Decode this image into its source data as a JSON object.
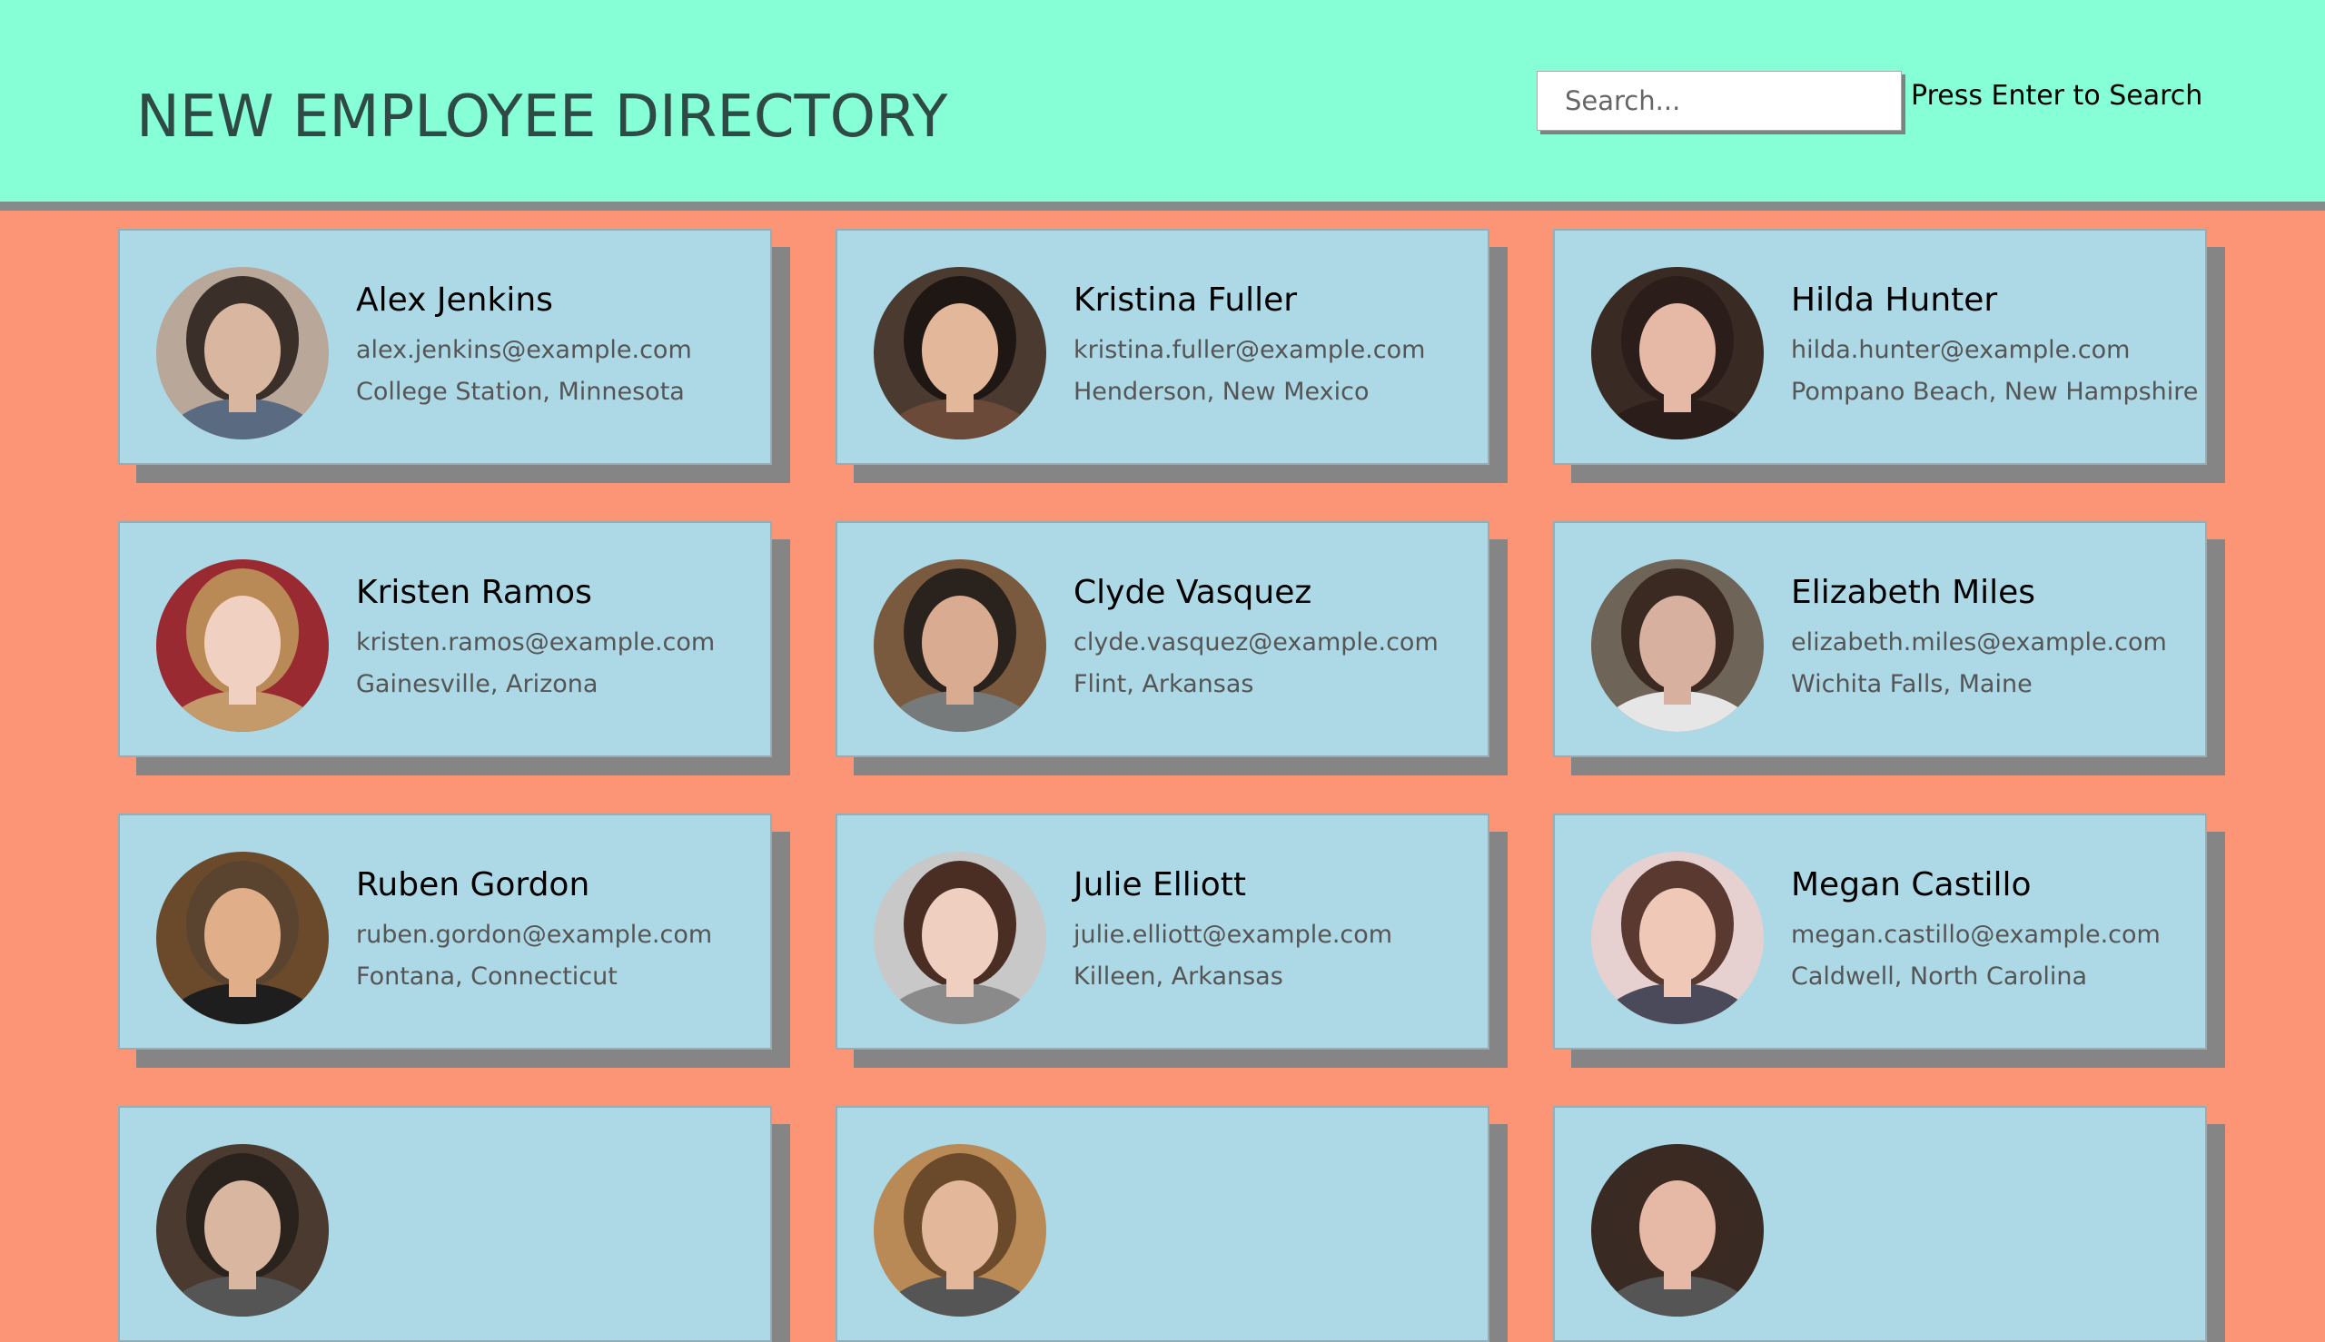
{
  "header": {
    "title": "NEW EMPLOYEE DIRECTORY",
    "search_placeholder": "Search...",
    "search_value": "",
    "search_hint": "Press Enter to Search"
  },
  "employees": [
    {
      "name": "Alex Jenkins",
      "email": "alex.jenkins@example.com",
      "location": "College Station, Minnesota",
      "photo_bg": "#b9a79a",
      "photo_skin": "#d8b6a0",
      "photo_hair": "#3a2f29",
      "photo_cloth": "#5a6a80"
    },
    {
      "name": "Kristina Fuller",
      "email": "kristina.fuller@example.com",
      "location": "Henderson, New Mexico",
      "photo_bg": "#4a3a30",
      "photo_skin": "#e2b79a",
      "photo_hair": "#1f1713",
      "photo_cloth": "#6c4a3a"
    },
    {
      "name": "Hilda Hunter",
      "email": "hilda.hunter@example.com",
      "location": "Pompano Beach, New Hampshire",
      "photo_bg": "#3a2a24",
      "photo_skin": "#e6b9a6",
      "photo_hair": "#2b1d19",
      "photo_cloth": "#2b1d19"
    },
    {
      "name": "Kristen Ramos",
      "email": "kristen.ramos@example.com",
      "location": "Gainesville, Arizona",
      "photo_bg": "#9a2a32",
      "photo_skin": "#f0d0c0",
      "photo_hair": "#b98a56",
      "photo_cloth": "#c49a6a"
    },
    {
      "name": "Clyde Vasquez",
      "email": "clyde.vasquez@example.com",
      "location": "Flint, Arkansas",
      "photo_bg": "#7a5a3e",
      "photo_skin": "#d9ab90",
      "photo_hair": "#2a221d",
      "photo_cloth": "#777a7a"
    },
    {
      "name": "Elizabeth Miles",
      "email": "elizabeth.miles@example.com",
      "location": "Wichita Falls, Maine",
      "photo_bg": "#6e6458",
      "photo_skin": "#d8b0a0",
      "photo_hair": "#3a2a22",
      "photo_cloth": "#e6e6e6"
    },
    {
      "name": "Ruben Gordon",
      "email": "ruben.gordon@example.com",
      "location": "Fontana, Connecticut",
      "photo_bg": "#6a4a2a",
      "photo_skin": "#e0ae88",
      "photo_hair": "#5a4430",
      "photo_cloth": "#1e1e1e"
    },
    {
      "name": "Julie Elliott",
      "email": "julie.elliott@example.com",
      "location": "Killeen, Arkansas",
      "photo_bg": "#c8c8c8",
      "photo_skin": "#efcfbf",
      "photo_hair": "#4a2e24",
      "photo_cloth": "#8a8a8a"
    },
    {
      "name": "Megan Castillo",
      "email": "megan.castillo@example.com",
      "location": "Caldwell, North Carolina",
      "photo_bg": "#e6d0d0",
      "photo_skin": "#f0c8b8",
      "photo_hair": "#5a3a30",
      "photo_cloth": "#4a4a5a"
    },
    {
      "name": "",
      "email": "",
      "location": "",
      "photo_bg": "#4a3a30",
      "photo_skin": "#d8b6a0",
      "photo_hair": "#2a221d",
      "photo_cloth": "#555555"
    },
    {
      "name": "",
      "email": "",
      "location": "",
      "photo_bg": "#b98a56",
      "photo_skin": "#e2b79a",
      "photo_hair": "#6a4a2a",
      "photo_cloth": "#555555"
    },
    {
      "name": "",
      "email": "",
      "location": "",
      "photo_bg": "#3a2a24",
      "photo_skin": "#e6b9a6",
      "photo_hair": "#3a2a22",
      "photo_cloth": "#555555"
    }
  ]
}
